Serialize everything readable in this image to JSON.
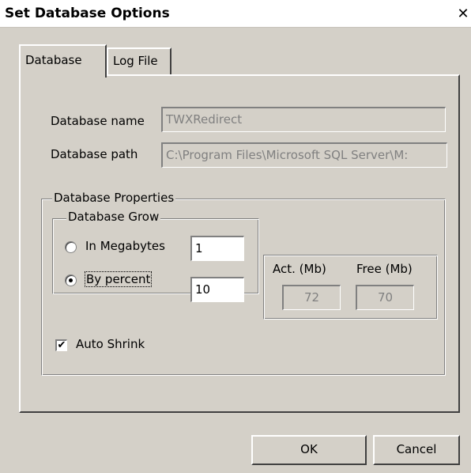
{
  "window": {
    "title": "Set Database Options",
    "close_glyph": "✕"
  },
  "tabs": [
    {
      "label": "Database",
      "active": true
    },
    {
      "label": "Log File",
      "active": false
    }
  ],
  "database": {
    "name_label": "Database name",
    "name_value": "TWXRedirect",
    "path_label": "Database path",
    "path_value": "C:\\Program Files\\Microsoft SQL Server\\M:"
  },
  "properties": {
    "group_title": "Database Properties",
    "grow": {
      "group_title": "Database Grow",
      "megabytes_label": "In Megabytes",
      "megabytes_value": "1",
      "percent_label": "By percent",
      "percent_value": "10",
      "selected": "percent"
    },
    "size": {
      "act_label": "Act. (Mb)",
      "act_value": "72",
      "free_label": "Free (Mb)",
      "free_value": "70"
    },
    "auto_shrink_label": "Auto Shrink",
    "auto_shrink_checked": true,
    "check_glyph": "✔"
  },
  "buttons": {
    "ok": "OK",
    "cancel": "Cancel"
  }
}
